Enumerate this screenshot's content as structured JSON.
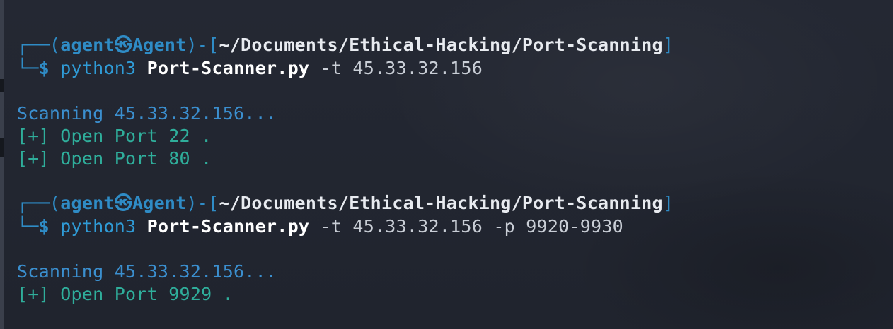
{
  "terminal": {
    "prompt": {
      "box_top": "┌──",
      "box_bottom": "└─",
      "open_paren": "(",
      "user": "agent",
      "at_symbol": "㉿",
      "host": "Agent",
      "close_paren": ")",
      "dash": "-",
      "open_bracket": "[",
      "path": "~/Documents/Ethical-Hacking/Port-Scanning",
      "close_bracket": "]",
      "symbol": "$"
    },
    "sessions": [
      {
        "command": {
          "program": "python3",
          "script": "Port-Scanner.py",
          "args": "-t 45.33.32.156"
        },
        "output": [
          {
            "text": "Scanning 45.33.32.156...",
            "kind": "scan"
          },
          {
            "text": "[+] Open Port 22 .",
            "kind": "open"
          },
          {
            "text": "[+] Open Port 80 .",
            "kind": "open"
          }
        ]
      },
      {
        "command": {
          "program": "python3",
          "script": "Port-Scanner.py",
          "args": "-t 45.33.32.156 -p 9920-9930"
        },
        "output": [
          {
            "text": "Scanning 45.33.32.156...",
            "kind": "scan"
          },
          {
            "text": "[+] Open Port 9929 .",
            "kind": "open"
          }
        ]
      }
    ]
  },
  "colors": {
    "background": "#222631",
    "prompt_blue": "#2f8cc6",
    "path_white": "#e8ebf0",
    "scan_blue": "#3b8fcf",
    "open_teal": "#2fae9b"
  }
}
